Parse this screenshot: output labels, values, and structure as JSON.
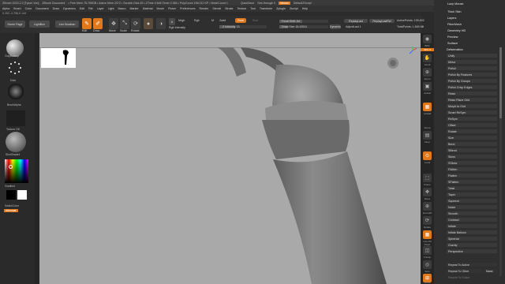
{
  "title_bar": {
    "items": [
      "ZBrush 2023.2.2 [Tyson Von]",
      "ZBrush Document",
      "• Free Mem 76.765GB • Active Mem 2072 • Scratch Disk 45 • ZTime 4.648 Timer 0.384 • PolyCount 198.012 KP • MeshCount 1",
      "QuickSave",
      "See-through 0",
      "Menus",
      "DefaultZScript"
    ]
  },
  "menu_bar": {
    "items": [
      "Alpha",
      "Brush",
      "Color",
      "Document",
      "Draw",
      "Dynamics",
      "Edit",
      "File",
      "Layer",
      "Light",
      "Macro",
      "Marker",
      "Material",
      "Movie",
      "Picker",
      "Preferences",
      "Render",
      "Stencil",
      "Stroke",
      "Texture",
      "Tool",
      "Transform",
      "Zplugin",
      "Zscript",
      "Help"
    ]
  },
  "coords_readout": "0.252,-0.756,0.144",
  "toolbar": {
    "home_page": "Home Page",
    "lightbox": "LightBox",
    "live_boolean": "Live Boolean",
    "edit": "Edit",
    "draw": "Draw",
    "move": "Move",
    "scale": "Scale",
    "rotate": "Rotate",
    "mrgb": "Mrgb",
    "rgb": "Rgb",
    "m": "M",
    "zadd": "Zadd",
    "zsub": "Zsub",
    "zcut": "Zcut",
    "rgb_intensity": "Rgb Intensity",
    "z_intensity": "Z Intensity 33",
    "focal_shift": "Focal Shift -54",
    "draw_size": "Draw Size 18.43511",
    "dynamic": "Dynamic",
    "replay_last": "ReplayLast",
    "replay_last_rel": "ReplayLastRel",
    "active_points": "ActivePoints: 195,602",
    "total_points": "TotalPoints: 1.845 Mil",
    "adjust_last": "AdjustLast 1",
    "z_intensity_fraction": 0.33,
    "focal_shift_fraction": 0.46,
    "draw_size_fraction": 0.18
  },
  "left_panel": {
    "brush_label": "ClayBuildup",
    "stroke_label": "Dots",
    "alpha_label": "BrushAlpha",
    "texture_label": "Texture Off",
    "material_label": "SkinShade4",
    "gradient_label": "Gradient",
    "switch_color": "SwitchColor",
    "alternate": "Alternate"
  },
  "right_shelf": {
    "items": [
      "BPR",
      "SPix 3",
      "Scroll",
      "Zoom",
      "Actual",
      "AAHalf",
      "Persp",
      "Floor",
      "Local",
      "Frame",
      "Move",
      "Zoom3D",
      "Rotate",
      "Line Fill PolyF",
      "Transp",
      "Solo",
      "Xpose"
    ]
  },
  "right_tray": {
    "top_items": [
      "Lazy Mouse",
      "Thick Skin",
      "Layers",
      "FiberMesh",
      "Geometry HD",
      "Preview",
      "Surface",
      "Deformation"
    ],
    "deformation_items": [
      "Unify",
      "Mirror",
      "Polish",
      "Polish By Features",
      "Polish By Groups",
      "Polish Crisp Edges",
      "Relax",
      "Relax Plane Grid",
      "Morph to Grid",
      "Smart ReSym",
      "ReSym",
      "Offset",
      "Rotate",
      "Size",
      "Bend",
      "SBend",
      "Skew",
      "SSkew",
      "FlAtten",
      "Flatten",
      "SFlatten",
      "Twist",
      "Taper",
      "Squeeze",
      "Noise",
      "Smooth",
      "Contract",
      "Inflate",
      "Inflate Balloon",
      "Spherize",
      "Gravity",
      "Perspective"
    ],
    "bottom_items": [
      "Repeat To Active",
      "Repeat To Other",
      "Mask",
      "Repeat To Folder"
    ]
  },
  "colors": {
    "accent": "#e0781c",
    "viewport_bg": "#a9a9a9",
    "model": "#7b7b7b"
  }
}
